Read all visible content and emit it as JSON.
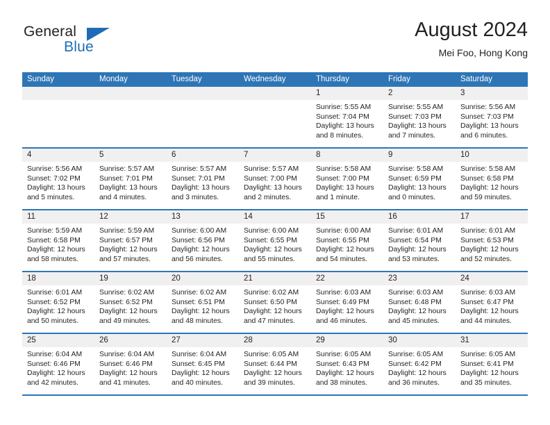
{
  "brand": {
    "name_top": "General",
    "name_bottom": "Blue",
    "accent_color": "#1f6cb5"
  },
  "header": {
    "title": "August 2024",
    "subtitle": "Mei Foo, Hong Kong"
  },
  "theme": {
    "header_row_color": "#2e75b6",
    "daynum_band_color": "#f0f0f0",
    "text_color": "#231f20"
  },
  "weekdays": [
    "Sunday",
    "Monday",
    "Tuesday",
    "Wednesday",
    "Thursday",
    "Friday",
    "Saturday"
  ],
  "weeks": [
    [
      {
        "day": "",
        "lines": []
      },
      {
        "day": "",
        "lines": []
      },
      {
        "day": "",
        "lines": []
      },
      {
        "day": "",
        "lines": []
      },
      {
        "day": "1",
        "lines": [
          "Sunrise: 5:55 AM",
          "Sunset: 7:04 PM",
          "Daylight: 13 hours",
          "and 8 minutes."
        ]
      },
      {
        "day": "2",
        "lines": [
          "Sunrise: 5:55 AM",
          "Sunset: 7:03 PM",
          "Daylight: 13 hours",
          "and 7 minutes."
        ]
      },
      {
        "day": "3",
        "lines": [
          "Sunrise: 5:56 AM",
          "Sunset: 7:03 PM",
          "Daylight: 13 hours",
          "and 6 minutes."
        ]
      }
    ],
    [
      {
        "day": "4",
        "lines": [
          "Sunrise: 5:56 AM",
          "Sunset: 7:02 PM",
          "Daylight: 13 hours",
          "and 5 minutes."
        ]
      },
      {
        "day": "5",
        "lines": [
          "Sunrise: 5:57 AM",
          "Sunset: 7:01 PM",
          "Daylight: 13 hours",
          "and 4 minutes."
        ]
      },
      {
        "day": "6",
        "lines": [
          "Sunrise: 5:57 AM",
          "Sunset: 7:01 PM",
          "Daylight: 13 hours",
          "and 3 minutes."
        ]
      },
      {
        "day": "7",
        "lines": [
          "Sunrise: 5:57 AM",
          "Sunset: 7:00 PM",
          "Daylight: 13 hours",
          "and 2 minutes."
        ]
      },
      {
        "day": "8",
        "lines": [
          "Sunrise: 5:58 AM",
          "Sunset: 7:00 PM",
          "Daylight: 13 hours",
          "and 1 minute."
        ]
      },
      {
        "day": "9",
        "lines": [
          "Sunrise: 5:58 AM",
          "Sunset: 6:59 PM",
          "Daylight: 13 hours",
          "and 0 minutes."
        ]
      },
      {
        "day": "10",
        "lines": [
          "Sunrise: 5:58 AM",
          "Sunset: 6:58 PM",
          "Daylight: 12 hours",
          "and 59 minutes."
        ]
      }
    ],
    [
      {
        "day": "11",
        "lines": [
          "Sunrise: 5:59 AM",
          "Sunset: 6:58 PM",
          "Daylight: 12 hours",
          "and 58 minutes."
        ]
      },
      {
        "day": "12",
        "lines": [
          "Sunrise: 5:59 AM",
          "Sunset: 6:57 PM",
          "Daylight: 12 hours",
          "and 57 minutes."
        ]
      },
      {
        "day": "13",
        "lines": [
          "Sunrise: 6:00 AM",
          "Sunset: 6:56 PM",
          "Daylight: 12 hours",
          "and 56 minutes."
        ]
      },
      {
        "day": "14",
        "lines": [
          "Sunrise: 6:00 AM",
          "Sunset: 6:55 PM",
          "Daylight: 12 hours",
          "and 55 minutes."
        ]
      },
      {
        "day": "15",
        "lines": [
          "Sunrise: 6:00 AM",
          "Sunset: 6:55 PM",
          "Daylight: 12 hours",
          "and 54 minutes."
        ]
      },
      {
        "day": "16",
        "lines": [
          "Sunrise: 6:01 AM",
          "Sunset: 6:54 PM",
          "Daylight: 12 hours",
          "and 53 minutes."
        ]
      },
      {
        "day": "17",
        "lines": [
          "Sunrise: 6:01 AM",
          "Sunset: 6:53 PM",
          "Daylight: 12 hours",
          "and 52 minutes."
        ]
      }
    ],
    [
      {
        "day": "18",
        "lines": [
          "Sunrise: 6:01 AM",
          "Sunset: 6:52 PM",
          "Daylight: 12 hours",
          "and 50 minutes."
        ]
      },
      {
        "day": "19",
        "lines": [
          "Sunrise: 6:02 AM",
          "Sunset: 6:52 PM",
          "Daylight: 12 hours",
          "and 49 minutes."
        ]
      },
      {
        "day": "20",
        "lines": [
          "Sunrise: 6:02 AM",
          "Sunset: 6:51 PM",
          "Daylight: 12 hours",
          "and 48 minutes."
        ]
      },
      {
        "day": "21",
        "lines": [
          "Sunrise: 6:02 AM",
          "Sunset: 6:50 PM",
          "Daylight: 12 hours",
          "and 47 minutes."
        ]
      },
      {
        "day": "22",
        "lines": [
          "Sunrise: 6:03 AM",
          "Sunset: 6:49 PM",
          "Daylight: 12 hours",
          "and 46 minutes."
        ]
      },
      {
        "day": "23",
        "lines": [
          "Sunrise: 6:03 AM",
          "Sunset: 6:48 PM",
          "Daylight: 12 hours",
          "and 45 minutes."
        ]
      },
      {
        "day": "24",
        "lines": [
          "Sunrise: 6:03 AM",
          "Sunset: 6:47 PM",
          "Daylight: 12 hours",
          "and 44 minutes."
        ]
      }
    ],
    [
      {
        "day": "25",
        "lines": [
          "Sunrise: 6:04 AM",
          "Sunset: 6:46 PM",
          "Daylight: 12 hours",
          "and 42 minutes."
        ]
      },
      {
        "day": "26",
        "lines": [
          "Sunrise: 6:04 AM",
          "Sunset: 6:46 PM",
          "Daylight: 12 hours",
          "and 41 minutes."
        ]
      },
      {
        "day": "27",
        "lines": [
          "Sunrise: 6:04 AM",
          "Sunset: 6:45 PM",
          "Daylight: 12 hours",
          "and 40 minutes."
        ]
      },
      {
        "day": "28",
        "lines": [
          "Sunrise: 6:05 AM",
          "Sunset: 6:44 PM",
          "Daylight: 12 hours",
          "and 39 minutes."
        ]
      },
      {
        "day": "29",
        "lines": [
          "Sunrise: 6:05 AM",
          "Sunset: 6:43 PM",
          "Daylight: 12 hours",
          "and 38 minutes."
        ]
      },
      {
        "day": "30",
        "lines": [
          "Sunrise: 6:05 AM",
          "Sunset: 6:42 PM",
          "Daylight: 12 hours",
          "and 36 minutes."
        ]
      },
      {
        "day": "31",
        "lines": [
          "Sunrise: 6:05 AM",
          "Sunset: 6:41 PM",
          "Daylight: 12 hours",
          "and 35 minutes."
        ]
      }
    ]
  ]
}
